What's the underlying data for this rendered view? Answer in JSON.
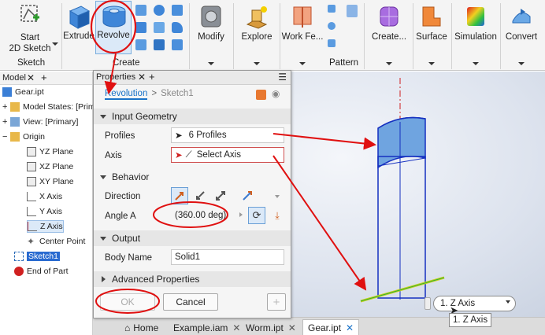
{
  "ribbon": {
    "start_sketch": {
      "line1": "Start",
      "line2": "2D Sketch"
    },
    "extrude": "Extrude",
    "revolve": "Revolve",
    "modify": "Modify",
    "explore": "Explore",
    "work_features": "Work Fe...",
    "create": "Create...",
    "surface": "Surface",
    "simulation": "Simulation",
    "convert": "Convert",
    "panels": {
      "sketch": "Sketch",
      "create": "Create",
      "pattern": "Pattern"
    }
  },
  "browser": {
    "tab": "Model",
    "items": [
      {
        "label": "Gear.ipt"
      },
      {
        "label": "Model States: [Prim"
      },
      {
        "label": "View: [Primary]"
      },
      {
        "label": "Origin"
      },
      {
        "label": "YZ Plane"
      },
      {
        "label": "XZ Plane"
      },
      {
        "label": "XY Plane"
      },
      {
        "label": "X Axis"
      },
      {
        "label": "Y Axis"
      },
      {
        "label": "Z Axis"
      },
      {
        "label": "Center Point"
      },
      {
        "label": "Sketch1"
      },
      {
        "label": "End of Part"
      }
    ]
  },
  "properties": {
    "tab": "Properties",
    "crumb_active": "Revolution",
    "crumb_sep": ">",
    "crumb_next": "Sketch1",
    "sections": {
      "input": "Input Geometry",
      "behavior": "Behavior",
      "output": "Output",
      "advanced": "Advanced Properties"
    },
    "profiles_label": "Profiles",
    "profiles_value": "6 Profiles",
    "axis_label": "Axis",
    "axis_value": "Select Axis",
    "direction_label": "Direction",
    "angle_label": "Angle A",
    "angle_value": "(360.00 deg)",
    "body_label": "Body Name",
    "body_value": "Solid1",
    "ok": "OK",
    "cancel": "Cancel",
    "plus": "+"
  },
  "viewport": {
    "axis_combo": "1. Z Axis",
    "axis_tooltip": "1. Z Axis"
  },
  "doc_tabs": [
    "Home",
    "Example.iam",
    "Worm.ipt",
    "Gear.ipt"
  ],
  "colors": {
    "accent": "#1a73c8",
    "annotation_red": "#e01010",
    "part_blue": "#3b7fd6"
  }
}
